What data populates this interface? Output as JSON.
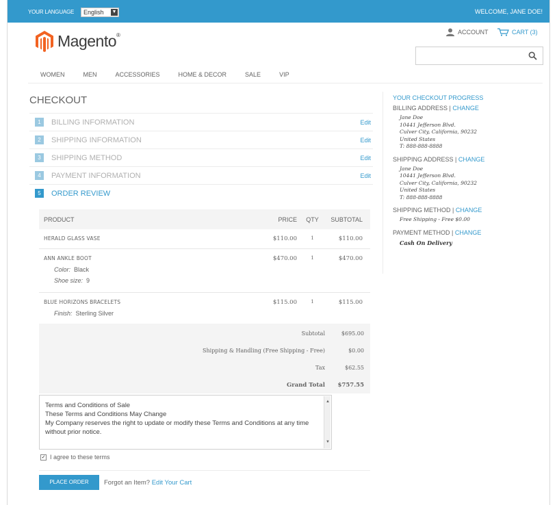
{
  "header": {
    "language_label": "YOUR LANGUAGE",
    "language_value": "English",
    "welcome": "WELCOME, JANE DOE!",
    "logo_text": "Magento",
    "logo_mark": "®",
    "account_label": "ACCOUNT",
    "cart_label": "CART (3)",
    "search_placeholder": ""
  },
  "nav": {
    "items": [
      "WOMEN",
      "MEN",
      "ACCESSORIES",
      "HOME & DECOR",
      "SALE",
      "VIP"
    ]
  },
  "checkout": {
    "title": "CHECKOUT",
    "steps": [
      {
        "num": "1",
        "label": "BILLING INFORMATION",
        "edit": "Edit"
      },
      {
        "num": "2",
        "label": "SHIPPING INFORMATION",
        "edit": "Edit"
      },
      {
        "num": "3",
        "label": "SHIPPING METHOD",
        "edit": "Edit"
      },
      {
        "num": "4",
        "label": "PAYMENT INFORMATION",
        "edit": "Edit"
      },
      {
        "num": "5",
        "label": "ORDER REVIEW",
        "edit": ""
      }
    ]
  },
  "review": {
    "headers": {
      "product": "PRODUCT",
      "price": "PRICE",
      "qty": "QTY",
      "subtotal": "SUBTOTAL"
    },
    "items": [
      {
        "name": "HERALD GLASS VASE",
        "price": "$110.00",
        "qty": "1",
        "subtotal": "$110.00"
      },
      {
        "name": "ANN ANKLE BOOT",
        "price": "$470.00",
        "qty": "1",
        "subtotal": "$470.00",
        "options": [
          {
            "label": "Color:",
            "value": "Black"
          },
          {
            "label": "Shoe size:",
            "value": "9"
          }
        ]
      },
      {
        "name": "BLUE HORIZONS BRACELETS",
        "price": "$115.00",
        "qty": "1",
        "subtotal": "$115.00",
        "options": [
          {
            "label": "Finish:",
            "value": "Sterling Silver"
          }
        ]
      }
    ],
    "totals": {
      "subtotal_label": "Subtotal",
      "subtotal": "$695.00",
      "shipping_label": "Shipping & Handling (Free Shipping - Free)",
      "shipping": "$0.00",
      "tax_label": "Tax",
      "tax": "$62.55",
      "grand_label": "Grand Total",
      "grand": "$757.55"
    },
    "terms": {
      "line1": "Terms and Conditions of Sale",
      "line2": "These Terms and Conditions May Change",
      "line3": "My Company reserves the right to update or modify these Terms and Conditions at any time without prior notice."
    },
    "agree_label": "I agree to these terms",
    "place_order": "PLACE ORDER",
    "forgot": "Forgot an Item?",
    "edit_cart": "Edit Your Cart"
  },
  "progress": {
    "title": "YOUR CHECKOUT PROGRESS",
    "change": "CHANGE",
    "billing_title": "BILLING ADDRESS",
    "billing": [
      "Jane Doe",
      "10441 Jefferson Blvd.",
      "Culver City, California, 90232",
      "United States",
      "T: 888-888-8888"
    ],
    "shipping_title": "SHIPPING ADDRESS",
    "shipping": [
      "Jane Doe",
      "10441 Jefferson Blvd.",
      "Culver City, California, 90232",
      "United States",
      "T: 888-888-8888"
    ],
    "method_title": "SHIPPING METHOD",
    "method": "Free Shipping - Free $0.00",
    "payment_title": "PAYMENT METHOD",
    "payment": "Cash On Delivery"
  },
  "colors": {
    "accent": "#3399cc",
    "step_inactive": "#9bc9e1",
    "panel": "#f4f4f4"
  }
}
